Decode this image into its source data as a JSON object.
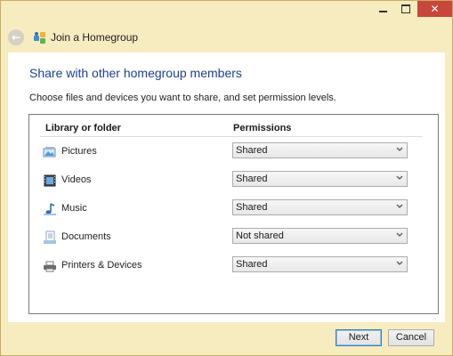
{
  "window": {
    "title": "Join a Homegroup",
    "controls": {
      "minimize": "minimize-icon",
      "maximize": "maximize-icon",
      "close": "close-icon",
      "close_glyph": "✕"
    },
    "back_icon": "back-arrow-icon",
    "title_icon": "homegroup-icon"
  },
  "main": {
    "heading": "Share with other homegroup members",
    "instructions": "Choose files and devices you want to share, and set permission levels."
  },
  "table": {
    "columns": {
      "library": "Library or folder",
      "permissions": "Permissions"
    },
    "rows": [
      {
        "label": "Pictures",
        "icon": "pictures-library-icon",
        "permission": "Shared"
      },
      {
        "label": "Videos",
        "icon": "videos-library-icon",
        "permission": "Shared"
      },
      {
        "label": "Music",
        "icon": "music-library-icon",
        "permission": "Shared"
      },
      {
        "label": "Documents",
        "icon": "documents-library-icon",
        "permission": "Not shared"
      },
      {
        "label": "Printers & Devices",
        "icon": "printer-icon",
        "permission": "Shared"
      }
    ]
  },
  "footer": {
    "next_label": "Next",
    "cancel_label": "Cancel"
  },
  "colors": {
    "heading": "#1e3f8f",
    "close_button": "#c7473a",
    "window_frame": "#f7ebc0"
  }
}
